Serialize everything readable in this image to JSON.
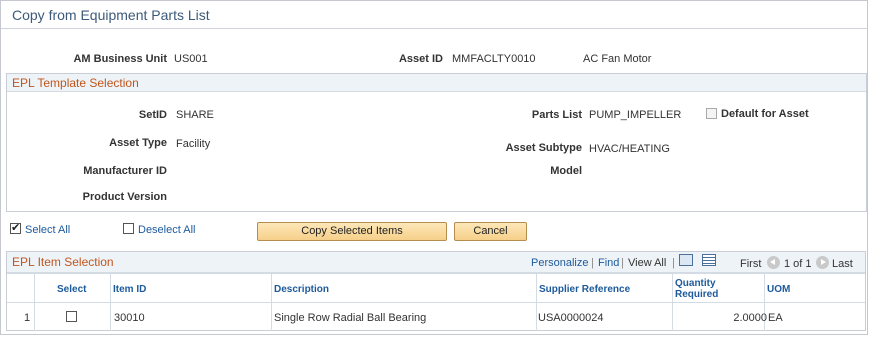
{
  "page": {
    "title": "Copy from Equipment Parts List"
  },
  "header": {
    "business_unit_label": "AM Business Unit",
    "business_unit_value": "US001",
    "asset_id_label": "Asset ID",
    "asset_id_value": "MMFACLTY0010",
    "asset_desc": "AC Fan Motor"
  },
  "epl_template": {
    "title": "EPL Template Selection",
    "setid_label": "SetID",
    "setid_value": "SHARE",
    "parts_list_label": "Parts List",
    "parts_list_value": "PUMP_IMPELLER",
    "default_label": "Default for Asset",
    "asset_type_label": "Asset Type",
    "asset_type_value": "Facility",
    "asset_subtype_label": "Asset Subtype",
    "asset_subtype_value": "HVAC/HEATING",
    "manufacturer_label": "Manufacturer ID",
    "model_label": "Model",
    "product_version_label": "Product Version"
  },
  "actions": {
    "select_all": "Select All",
    "deselect_all": "Deselect All",
    "copy_button": "Copy Selected Items",
    "cancel_button": "Cancel"
  },
  "item_grid": {
    "title": "EPL Item Selection",
    "toolbar": {
      "personalize": "Personalize",
      "sep1": "|",
      "find": "Find",
      "sep2": "|",
      "view_all": "View All",
      "sep3": "|",
      "first": "First",
      "range": "1 of 1",
      "last": "Last"
    },
    "columns": {
      "select": "Select",
      "item_id": "Item ID",
      "description": "Description",
      "supplier_ref": "Supplier Reference",
      "quantity_line1": "Quantity",
      "quantity_line2": "Required",
      "uom": "UOM"
    },
    "rows": [
      {
        "num": "1",
        "item_id": "30010",
        "description": "Single Row Radial Ball Bearing",
        "supplier_ref": "USA0000024",
        "quantity": "2.0000",
        "uom": "EA"
      }
    ]
  }
}
